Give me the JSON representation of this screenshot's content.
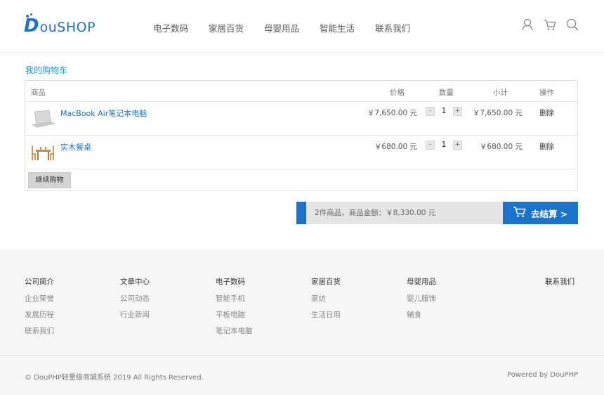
{
  "header": {
    "logo_mark": "D",
    "logo_text": "ouSHOP",
    "nav": [
      "电子数码",
      "家居百货",
      "母婴用品",
      "智能生活",
      "联系我们"
    ],
    "icons": [
      "user-icon",
      "cart-icon",
      "search-icon"
    ]
  },
  "cart": {
    "title": "我的购物车",
    "columns": {
      "product": "商品",
      "price": "价格",
      "quantity": "数量",
      "subtotal": "小计",
      "action": "操作"
    },
    "items": [
      {
        "name": "MacBook Air笔记本电脑",
        "price": "￥7,650.00 元",
        "qty": "1",
        "subtotal": "￥7,650.00 元",
        "action": "删除",
        "thumb_icon": "laptop-icon"
      },
      {
        "name": "实木餐桌",
        "price": "￥680.00 元",
        "qty": "1",
        "subtotal": "￥680.00 元",
        "action": "删除",
        "thumb_icon": "dining-table-icon"
      }
    ],
    "qty_minus": "-",
    "qty_plus": "+",
    "continue_label": "继续购物",
    "summary": "2件商品，商品金额：￥8,330.00 元",
    "checkout_label": "去结算 >"
  },
  "footer": {
    "columns": [
      {
        "title": "公司简介",
        "links": [
          "企业荣誉",
          "发展历程",
          "联系我们"
        ]
      },
      {
        "title": "文章中心",
        "links": [
          "公司动态",
          "行业新闻"
        ]
      },
      {
        "title": "电子数码",
        "links": [
          "智能手机",
          "平板电脑",
          "笔记本电脑"
        ]
      },
      {
        "title": "家居百货",
        "links": [
          "家纺",
          "生活日用"
        ]
      },
      {
        "title": "母婴用品",
        "links": [
          "婴儿服饰",
          "辅食"
        ]
      },
      {
        "title": "联系我们",
        "links": []
      }
    ],
    "copyright": "© DouPHP轻量级商城系统 2019 All Rights Reserved.",
    "powered": "Powered by DouPHP"
  },
  "colors": {
    "brand": "#1a73c9",
    "title_blue": "#1a9ad6",
    "footer_bg": "#f7f7f7"
  }
}
